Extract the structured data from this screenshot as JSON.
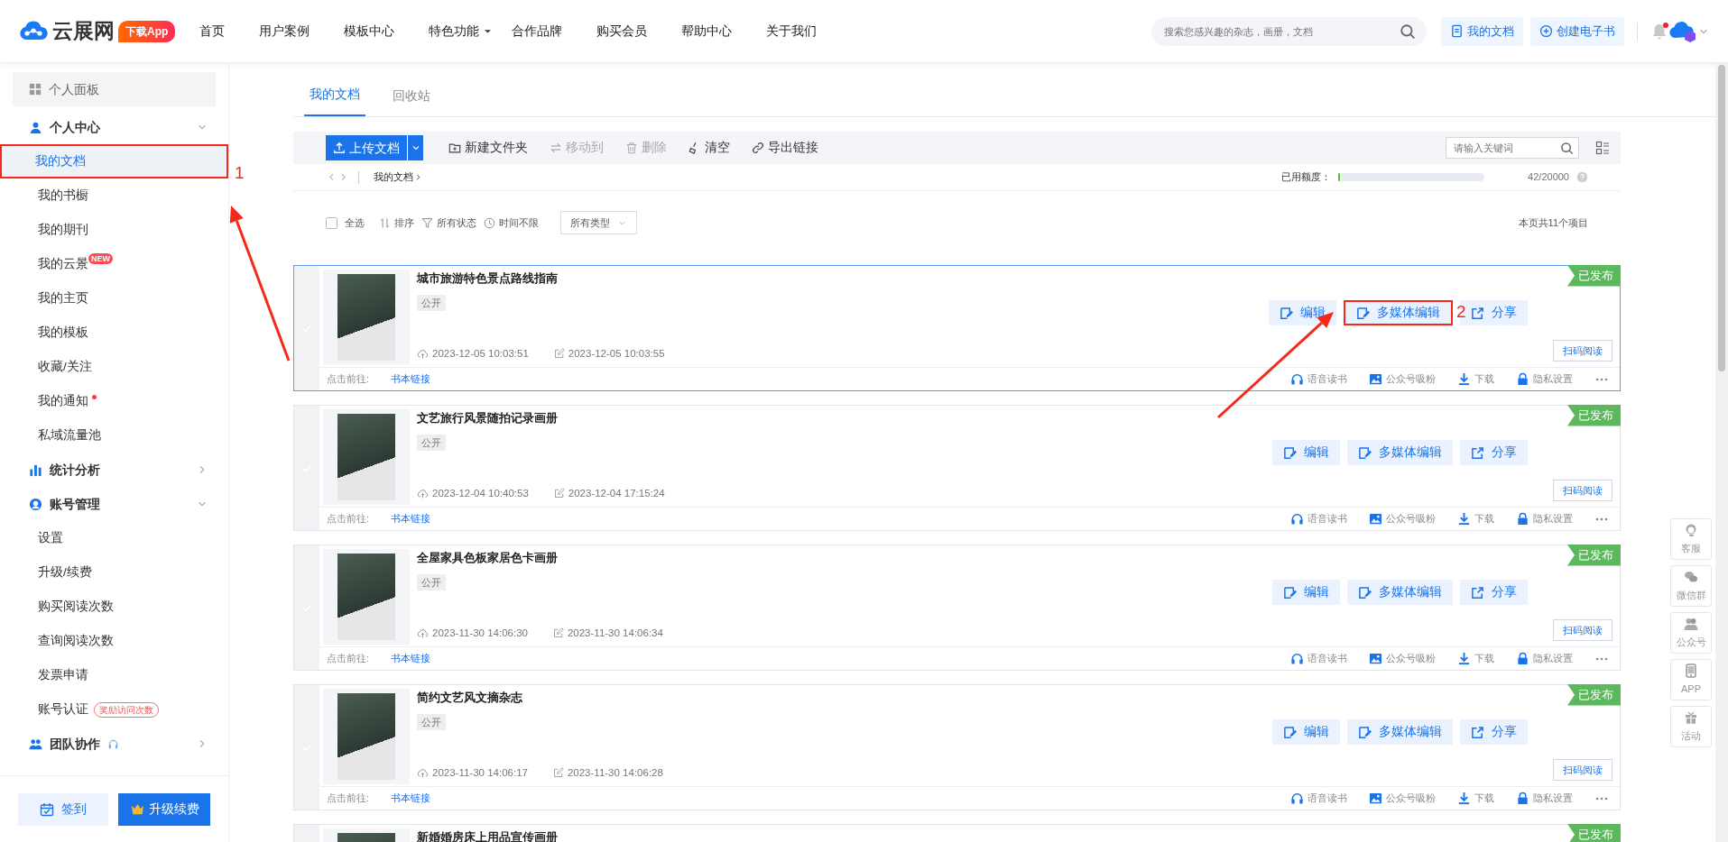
{
  "header": {
    "logo": "云展网",
    "app_badge": "下载App",
    "nav": [
      {
        "label": "首页",
        "dropdown": false
      },
      {
        "label": "用户案例",
        "dropdown": false
      },
      {
        "label": "模板中心",
        "dropdown": false
      },
      {
        "label": "特色功能",
        "dropdown": true
      },
      {
        "label": "合作品牌",
        "dropdown": false
      },
      {
        "label": "购买会员",
        "dropdown": false
      },
      {
        "label": "帮助中心",
        "dropdown": false
      },
      {
        "label": "关于我们",
        "dropdown": false
      }
    ],
    "search": {
      "placeholder": "搜索您感兴趣的杂志，画册，文档"
    },
    "buttons": [
      "我的文档",
      "创建电子书"
    ],
    "notification_dot": true
  },
  "sidebar": {
    "panel": "个人面板",
    "groups": [
      {
        "label": "个人中心",
        "expanded": true,
        "items": [
          {
            "label": "我的文档",
            "selected": true,
            "highlighted": true
          },
          {
            "label": "我的书橱",
            "selected": false
          },
          {
            "label": "我的期刊",
            "selected": false
          },
          {
            "label": "我的云景",
            "selected": false,
            "badge": "NEW"
          },
          {
            "label": "我的主页",
            "selected": false
          },
          {
            "label": "我的模板",
            "selected": false
          },
          {
            "label": "收藏/关注",
            "selected": false
          },
          {
            "label": "我的通知",
            "selected": false,
            "dot": true
          },
          {
            "label": "私域流量池",
            "selected": false
          }
        ]
      },
      {
        "label": "统计分析",
        "expanded": false
      },
      {
        "label": "账号管理",
        "expanded": true,
        "items": [
          {
            "label": "设置",
            "selected": false
          },
          {
            "label": "升级/续费",
            "selected": false
          },
          {
            "label": "购买阅读次数",
            "selected": false
          },
          {
            "label": "查询阅读次数",
            "selected": false
          },
          {
            "label": "发票申请",
            "selected": false
          },
          {
            "label": "账号认证",
            "selected": false,
            "tag": "奖励访问次数"
          }
        ]
      },
      {
        "label": "团队协作",
        "expanded": false
      }
    ],
    "footer_buttons": [
      "签到",
      "升级续费"
    ]
  },
  "tabs": [
    {
      "label": "我的文档",
      "selected": true
    },
    {
      "label": "回收站",
      "selected": false
    }
  ],
  "toolbar": {
    "upload": "上传文档",
    "actions": [
      {
        "label": "新建文件夹",
        "disabled": false
      },
      {
        "label": "移动到",
        "disabled": true
      },
      {
        "label": "删除",
        "disabled": true
      },
      {
        "label": "清空",
        "disabled": false
      },
      {
        "label": "导出链接",
        "disabled": false
      }
    ],
    "search": {
      "placeholder": "请输入关键词"
    }
  },
  "breadcrumb": [
    "我的文档"
  ],
  "quota": {
    "label": "已用额度：",
    "level": 0.0021,
    "reading": "42/20000"
  },
  "filters": {
    "select_all": {
      "label": "全选",
      "checked": false
    },
    "sort": "排序",
    "status": "所有状态",
    "time": "时间不限",
    "type": "所有类型",
    "count": "本页共11个项目"
  },
  "documents": [
    {
      "title": "城市旅游特色景点路线指南",
      "selected": true,
      "checked": false,
      "tag": "公开",
      "created": "2023-12-05 10:03:51",
      "modified": "2023-12-05 10:03:55",
      "status": "已发布",
      "actions": [
        {
          "label": "编辑",
          "highlighted": false
        },
        {
          "label": "多媒体编辑",
          "highlighted": true
        },
        {
          "label": "分享",
          "highlighted": false
        }
      ],
      "scan": "扫码阅读",
      "link_label": "点击前往:",
      "link": "书本链接",
      "tools": [
        "语音读书",
        "公众号吸粉",
        "下载",
        "隐私设置"
      ]
    },
    {
      "title": "文艺旅行风景随拍记录画册",
      "selected": false,
      "checked": false,
      "tag": "公开",
      "created": "2023-12-04 10:40:53",
      "modified": "2023-12-04 17:15:24",
      "status": "已发布",
      "actions": [
        {
          "label": "编辑",
          "highlighted": false
        },
        {
          "label": "多媒体编辑",
          "highlighted": false
        },
        {
          "label": "分享",
          "highlighted": false
        }
      ],
      "scan": "扫码阅读",
      "link_label": "点击前往:",
      "link": "书本链接",
      "tools": [
        "语音读书",
        "公众号吸粉",
        "下载",
        "隐私设置"
      ]
    },
    {
      "title": "全屋家具色板家居色卡画册",
      "selected": false,
      "checked": false,
      "tag": "公开",
      "created": "2023-11-30 14:06:30",
      "modified": "2023-11-30 14:06:34",
      "status": "已发布",
      "actions": [
        {
          "label": "编辑",
          "highlighted": false
        },
        {
          "label": "多媒体编辑",
          "highlighted": false
        },
        {
          "label": "分享",
          "highlighted": false
        }
      ],
      "scan": "扫码阅读",
      "link_label": "点击前往:",
      "link": "书本链接",
      "tools": [
        "语音读书",
        "公众号吸粉",
        "下载",
        "隐私设置"
      ]
    },
    {
      "title": "简约文艺风文摘杂志",
      "selected": false,
      "checked": false,
      "tag": "公开",
      "created": "2023-11-30 14:06:17",
      "modified": "2023-11-30 14:06:28",
      "status": "已发布",
      "actions": [
        {
          "label": "编辑",
          "highlighted": false
        },
        {
          "label": "多媒体编辑",
          "highlighted": false
        },
        {
          "label": "分享",
          "highlighted": false
        }
      ],
      "scan": "扫码阅读",
      "link_label": "点击前往:",
      "link": "书本链接",
      "tools": [
        "语音读书",
        "公众号吸粉",
        "下载",
        "隐私设置"
      ]
    },
    {
      "title": "新婚婚房床上用品宣传画册",
      "selected": false,
      "status": "已发布"
    }
  ],
  "annotations": [
    {
      "label": "1"
    },
    {
      "label": "2"
    }
  ],
  "float_bar": [
    "客服",
    "微信群",
    "公众号",
    "APP",
    "活动"
  ]
}
